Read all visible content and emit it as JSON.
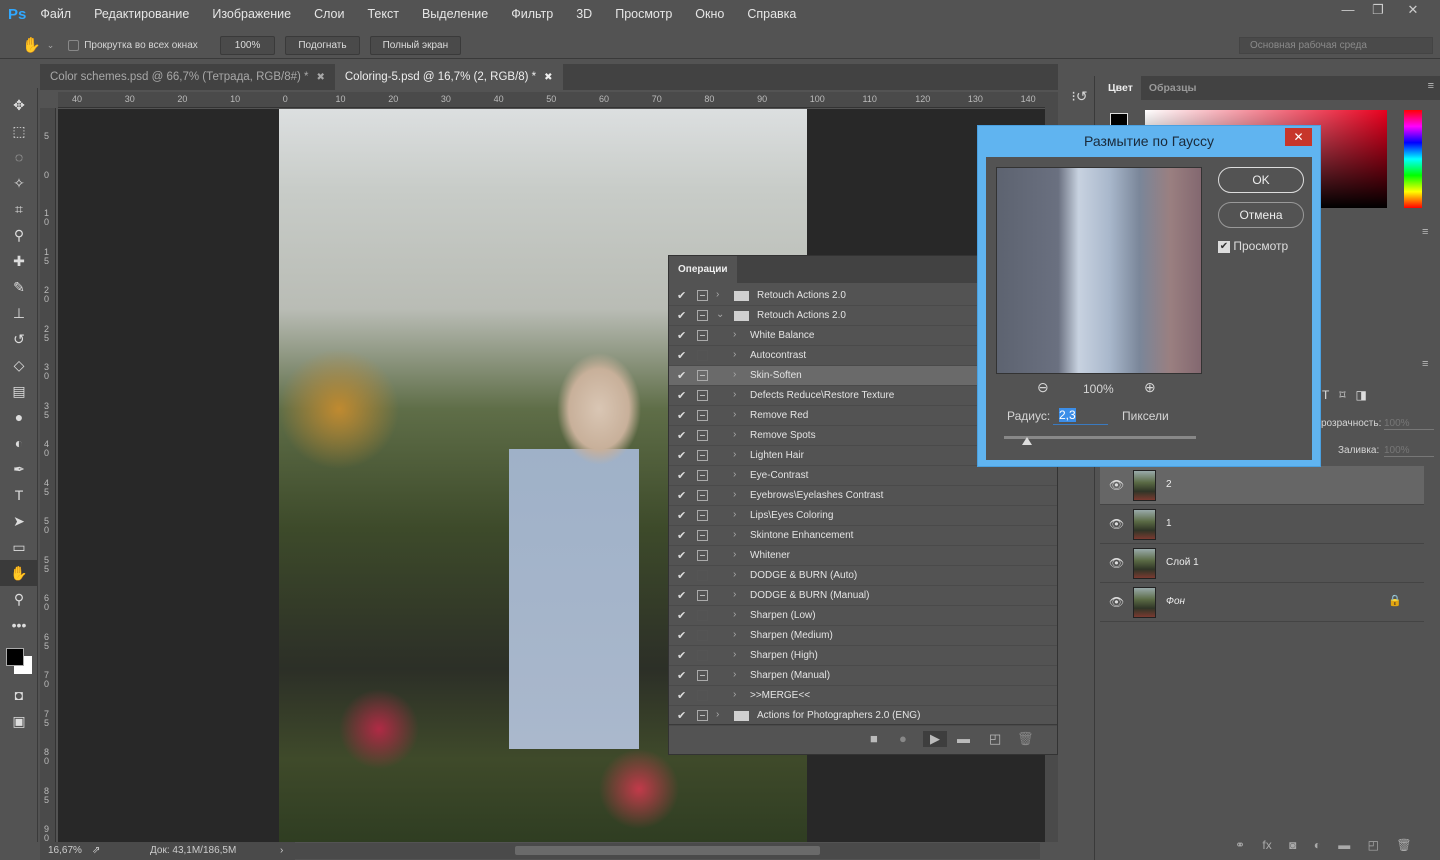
{
  "app": {
    "logo": "Ps",
    "menu": [
      "Файл",
      "Редактирование",
      "Изображение",
      "Слои",
      "Текст",
      "Выделение",
      "Фильтр",
      "3D",
      "Просмотр",
      "Окно",
      "Справка"
    ],
    "window_controls": [
      "minimize",
      "restore",
      "close"
    ]
  },
  "options": {
    "tool_icon": "hand-icon",
    "scroll_all": "Прокрутка во всех окнах",
    "zoom": "100%",
    "fit": "Подогнать",
    "fullscreen": "Полный экран",
    "workspace": "Основная рабочая среда"
  },
  "tabs": [
    {
      "label": "Color schemes.psd @ 66,7% (Тетрада, RGB/8#) *",
      "active": false
    },
    {
      "label": "Coloring-5.psd @ 16,7% (2, RGB/8) *",
      "active": true
    }
  ],
  "rulers": {
    "h": [
      "40",
      "30",
      "20",
      "10",
      "0",
      "10",
      "20",
      "30",
      "40",
      "50",
      "60",
      "70",
      "80",
      "90",
      "100",
      "110",
      "120",
      "130",
      "140"
    ],
    "v": [
      "5",
      "0",
      "1 0",
      "1 5",
      "2 0",
      "2 5",
      "3 0",
      "3 5",
      "4 0",
      "4 5",
      "5 0",
      "5 5",
      "6 0",
      "6 5",
      "7 0",
      "7 5",
      "8 0",
      "8 5",
      "9 0"
    ]
  },
  "status": {
    "zoom": "16,67%",
    "doc": "Док: 43,1M/186,5M"
  },
  "actions": {
    "tab": "Операции",
    "rows": [
      {
        "label": "Retouch Actions 2.0",
        "folder": true,
        "expanded": false,
        "dialog": true
      },
      {
        "label": "Retouch Actions 2.0",
        "folder": true,
        "expanded": true,
        "dialog": true
      },
      {
        "label": "White Balance",
        "dialog": true
      },
      {
        "label": "Autocontrast",
        "dialog": false
      },
      {
        "label": "Skin-Soften",
        "dialog": true,
        "selected": true
      },
      {
        "label": "Defects Reduce\\Restore Texture",
        "dialog": true
      },
      {
        "label": "Remove Red",
        "dialog": true
      },
      {
        "label": "Remove Spots",
        "dialog": true
      },
      {
        "label": "Lighten Hair",
        "dialog": true
      },
      {
        "label": "Eye-Contrast",
        "dialog": true
      },
      {
        "label": "Eyebrows\\Eyelashes Contrast",
        "dialog": true
      },
      {
        "label": "Lips\\Eyes Coloring",
        "dialog": true
      },
      {
        "label": "Skintone Enhancement",
        "dialog": true
      },
      {
        "label": "Whitener",
        "dialog": true
      },
      {
        "label": "DODGE & BURN (Auto)",
        "dialog": false
      },
      {
        "label": "DODGE & BURN (Manual)",
        "dialog": true
      },
      {
        "label": "Sharpen (Low)",
        "dialog": false
      },
      {
        "label": "Sharpen (Medium)",
        "dialog": false
      },
      {
        "label": "Sharpen (High)",
        "dialog": false
      },
      {
        "label": "Sharpen (Manual)",
        "dialog": true
      },
      {
        "label": ">>MERGE<<",
        "dialog": false
      },
      {
        "label": "Actions for Photographers 2.0 (ENG)",
        "folder": true,
        "expanded": false,
        "dialog": true
      }
    ],
    "buttons": [
      "stop-icon",
      "record-icon",
      "play-icon",
      "folder-icon",
      "new-action-icon",
      "trash-icon"
    ]
  },
  "color_panel": {
    "tabs": [
      "Цвет",
      "Образцы"
    ],
    "accent": "#e8001e"
  },
  "layers": {
    "opacity_label": "розрачность:",
    "opacity": "100%",
    "fill_label": "Заливка:",
    "fill": "100%",
    "items": [
      {
        "name": "2",
        "selected": true
      },
      {
        "name": "1"
      },
      {
        "name": "Слой 1"
      },
      {
        "name": "Фон",
        "locked": true
      }
    ]
  },
  "dialog": {
    "title": "Размытие по Гауссу",
    "ok": "OK",
    "cancel": "Отмена",
    "preview_label": "Просмотр",
    "preview_checked": true,
    "zoom": "100%",
    "radius_label": "Радиус:",
    "radius": "2,3",
    "unit": "Пиксели"
  }
}
